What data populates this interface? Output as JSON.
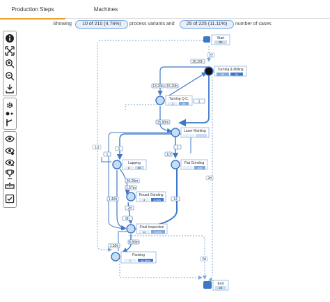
{
  "tabs": [
    {
      "label": "Production Steps",
      "active": true
    },
    {
      "label": "Machines",
      "active": false
    }
  ],
  "summary": {
    "prefix": "Showing",
    "variants_pill": "10 of 210 (4.76%)",
    "variants_suffix": "process variants and",
    "cases_pill": "25 of 225 (11.11%)",
    "cases_suffix": "number of cases"
  },
  "toolbar_icons": [
    "info-icon",
    "fit-screen-icon",
    "zoom-in-icon",
    "zoom-out-icon",
    "download-icon",
    "settings-icon",
    "nodes-icon",
    "path-icon",
    "eye-icon",
    "eye-settings-icon",
    "eye-alt-icon",
    "trophy-icon",
    "ruler-icon",
    "checkbox-icon"
  ],
  "nodes": {
    "start": {
      "label": "Start",
      "count": "25"
    },
    "turning_milling": {
      "label": "Turning & Milling",
      "v1": "69",
      "v2": "2d"
    },
    "turning_qc": {
      "label": "Turning Q.C.",
      "v1": "2",
      "v2": "5h"
    },
    "laser_marking": {
      "label": "Laser Marking",
      "v1": "",
      "v2": ""
    },
    "lapping": {
      "label": "Lapping",
      "v1": "6",
      "v2": "5h"
    },
    "flat_grinding": {
      "label": "Flat Grinding",
      "v1": "",
      "v2": "23h"
    },
    "round_grinding": {
      "label": "Round Grinding",
      "v1": "3",
      "v2": "8.02h"
    },
    "final_inspection": {
      "label": "Final Inspection",
      "v1": "11",
      "v2": "5.20h"
    },
    "packing": {
      "label": "Packing",
      "v1": "1",
      "v2": "42.50m"
    },
    "end": {
      "label": "End",
      "count": "24"
    }
  },
  "edge_labels": {
    "start_tm": "22",
    "tm_self": "26.20h",
    "tm_qc": "13.26h",
    "qc_tm": "15.20h",
    "qc_lm": "1",
    "tm_lm": "15.90m",
    "lm_lap": "1",
    "lm_fg": "1",
    "lm_left": "1d",
    "lap_rg": "26.00m",
    "rg_fi": "2d",
    "lap_fi": "1.40h",
    "fg_fi": "14",
    "fi_pack": "8.80m",
    "fi_pack2": "1.50h",
    "pack_end": "2d",
    "left_loop": "1d",
    "right_loop": "2d",
    "lm_fi": "6h",
    "rg_left": "1.57m",
    "qc_left": "1"
  },
  "colors": {
    "node_fill": "#c8dcf2",
    "node_border": "#3d78c8",
    "edge": "#3d78c8",
    "edge_dashed": "#7fa9d9",
    "tab_active": "#f0a030"
  }
}
